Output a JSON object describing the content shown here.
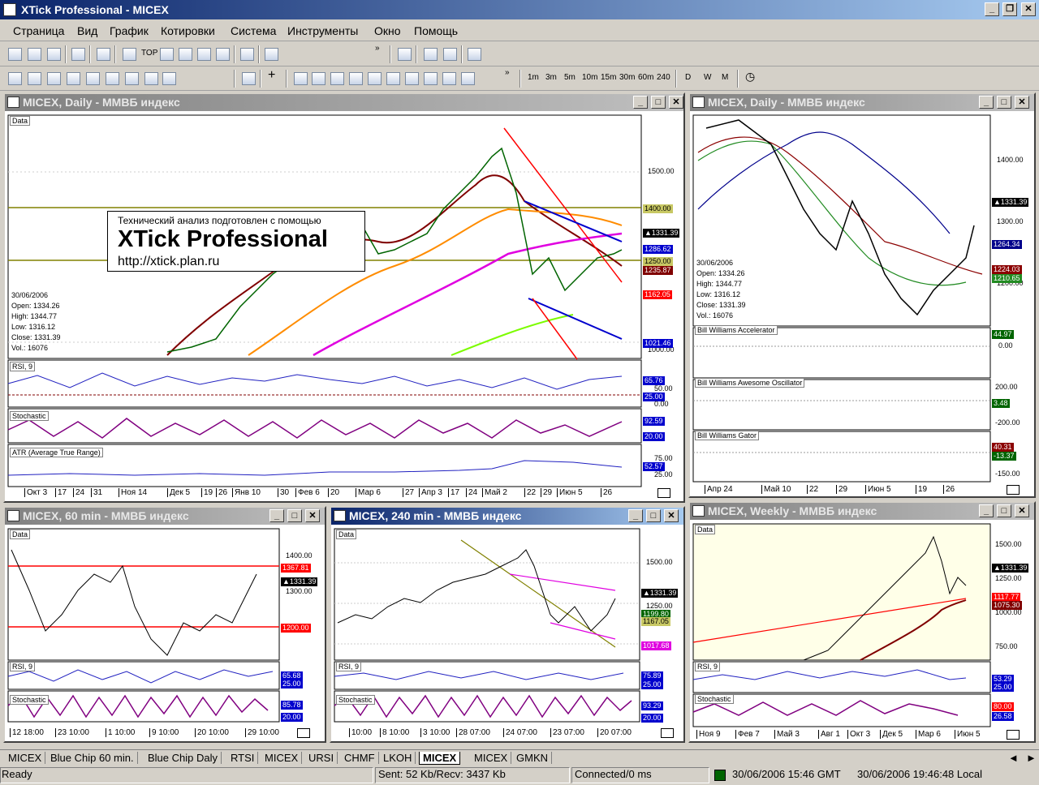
{
  "app": {
    "title": "XTick Professional - MICEX"
  },
  "menu": [
    "Страница",
    "Вид",
    "График",
    "Котировки",
    "Система",
    "Инструменты",
    "Окно",
    "Помощь"
  ],
  "toolbar1": {
    "top_label": "TOP"
  },
  "toolbar2": {
    "timeframes": [
      "1m",
      "3m",
      "5m",
      "10m",
      "15m",
      "30m",
      "60m",
      "240",
      "D",
      "W",
      "M"
    ]
  },
  "windows": {
    "main_daily": {
      "title": "MICEX, Daily - ММВБ индекс",
      "logo_line1": "Технический анализ подготовлен с помощью",
      "logo_line2": "XTick Professional",
      "logo_line3": "http://xtick.plan.ru",
      "data_label": "Data",
      "info": [
        "30/06/2006",
        "Open: 1334.26",
        "High: 1344.77",
        "Low: 1316.12",
        "Close: 1331.39",
        "Vol.: 16076"
      ],
      "yaxis": [
        "1500.00",
        "1000.00"
      ],
      "tags": [
        "1400.00",
        "▲1331.39",
        "1286.62",
        "1250.00",
        "1235.87",
        "1162.05",
        "1021.46"
      ],
      "rsi_label": "RSI, 9",
      "rsi_tags": [
        "65.76",
        "50.00",
        "25.00",
        "0.00"
      ],
      "stoch_label": "Stochastic",
      "stoch_tags": [
        "92.59",
        "20.00"
      ],
      "atr_label": "ATR (Average True Range)",
      "atr_tags": [
        "75.00",
        "52.57",
        "25.00"
      ],
      "xaxis": [
        "Окт 3",
        "17",
        "24",
        "31",
        "Ноя 14",
        "Дек 5",
        "19",
        "26",
        "Янв 10",
        "30",
        "Фев 6",
        "20",
        "Мар 6",
        "27",
        "Апр 3",
        "17",
        "24",
        "Май 2",
        "22",
        "29",
        "Июн 5",
        "26"
      ]
    },
    "right_daily": {
      "title": "MICEX, Daily - ММВБ индекс",
      "info": [
        "30/06/2006",
        "Open: 1334.26",
        "High: 1344.77",
        "Low: 1316.12",
        "Close: 1331.39",
        "Vol.: 16076"
      ],
      "yaxis": [
        "1400.00",
        "1300.00",
        "1200.00"
      ],
      "tags": [
        "▲1331.39",
        "1264.34",
        "1224.03",
        "1210.65"
      ],
      "acc_label": "Bill Williams Accelerator",
      "acc_tags": [
        "44.97",
        "0.00"
      ],
      "ao_label": "Bill Williams Awesome Oscillator",
      "ao_tags": [
        "200.00",
        "3.48",
        "-200.00"
      ],
      "gator_label": "Bill Williams Gator",
      "gator_tags": [
        "40.31",
        "-13.37",
        "-150.00"
      ],
      "xaxis": [
        "Апр 24",
        "Май 10",
        "22",
        "29",
        "Июн 5",
        "19",
        "26"
      ]
    },
    "min60": {
      "title": "MICEX, 60 min - ММВБ индекс",
      "data_label": "Data",
      "yaxis": [
        "1400.00",
        "1300.00"
      ],
      "tags": [
        "1367.81",
        "▲1331.39",
        "1200.00"
      ],
      "rsi_label": "RSI, 9",
      "rsi_tags": [
        "65.68",
        "25.00"
      ],
      "stoch_label": "Stochastic",
      "stoch_tags": [
        "85.78",
        "20.00"
      ],
      "xaxis": [
        "12 18:00",
        "23 10:00",
        "1 10:00",
        "9 10:00",
        "20 10:00",
        "29 10:00"
      ]
    },
    "min240": {
      "title": "MICEX, 240 min - ММВБ индекс",
      "data_label": "Data",
      "yaxis": [
        "1500.00"
      ],
      "tags": [
        "▲1331.39",
        "1250.00",
        "1199.80",
        "1167.05",
        "1017.68"
      ],
      "rsi_label": "RSI, 9",
      "rsi_tags": [
        "75.89",
        "25.00"
      ],
      "stoch_label": "Stochastic",
      "stoch_tags": [
        "93.29",
        "20.00"
      ],
      "xaxis": [
        "10:00",
        "8 10:00",
        "3 10:00",
        "28 07:00",
        "24 07:00",
        "23 07:00",
        "20 07:00"
      ]
    },
    "weekly": {
      "title": "MICEX, Weekly - ММВБ индекс",
      "data_label": "Data",
      "yaxis": [
        "1500.00",
        "1250.00",
        "1000.00",
        "750.00"
      ],
      "tags": [
        "▲1331.39",
        "1117.77",
        "1075.30"
      ],
      "rsi_label": "RSI, 9",
      "rsi_tags": [
        "53.29",
        "25.00"
      ],
      "stoch_label": "Stochastic",
      "stoch_tags": [
        "80.00",
        "26.58"
      ],
      "xaxis": [
        "Ноя 9",
        "Фев 7",
        "Май 3",
        "Авг 1",
        "Окт 3",
        "Дек 5",
        "Мар 6",
        "Июн 5"
      ]
    }
  },
  "tabs": [
    "MICEX",
    "Blue Chip 60 min.",
    "Blue Chip Daly",
    "RTSI",
    "MICEX",
    "URSI",
    "CHMF",
    "LKOH",
    "MICEX",
    "MICEX",
    "GMKN"
  ],
  "active_tab": "MICEX",
  "status": {
    "ready": "Ready",
    "traffic": "Sent: 52 Kb/Recv: 3437 Kb",
    "connection": "Connected/0 ms",
    "gmt": "30/06/2006 15:46 GMT",
    "local": "30/06/2006 19:46:48 Local"
  },
  "colors": {
    "active_title": "#0a246a",
    "inactive_title": "#808080",
    "weekly_bg": "#ffffe8"
  }
}
